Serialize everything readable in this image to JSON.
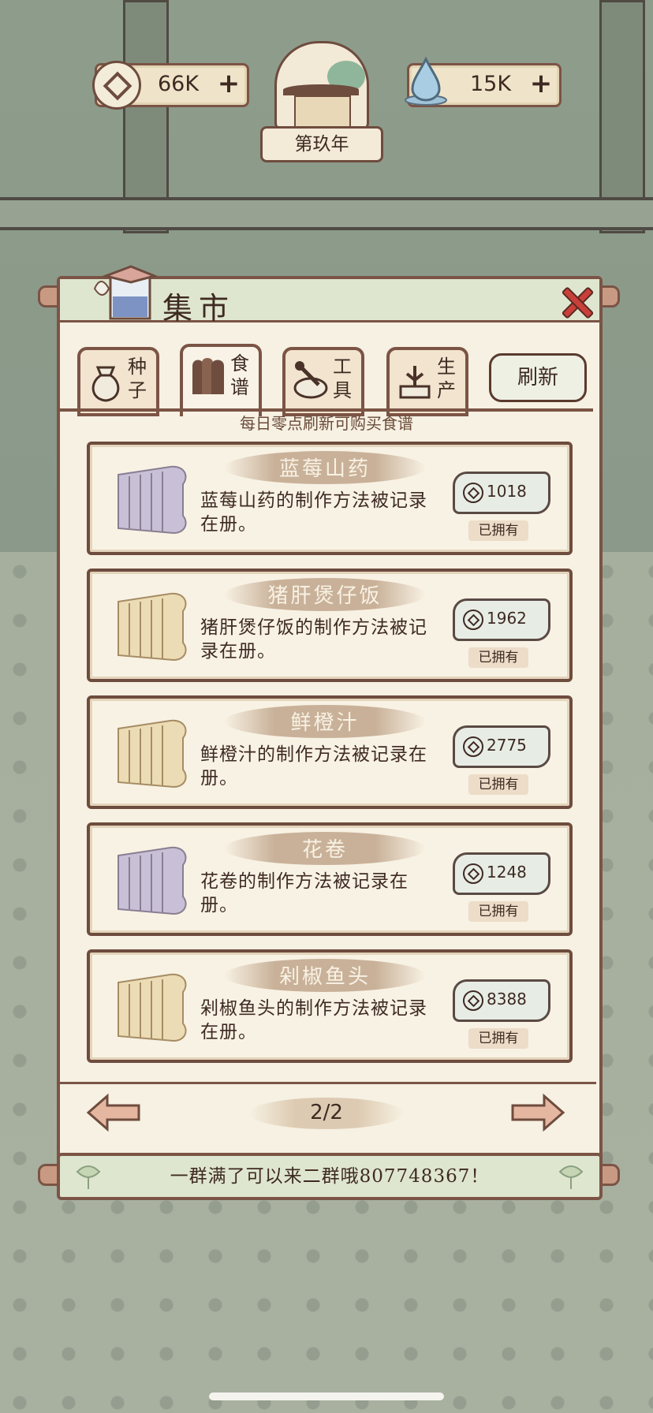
{
  "hud": {
    "coins": "66K",
    "water": "15K",
    "plus": "+",
    "year": "第玖年"
  },
  "panel": {
    "title": "集市",
    "hint": "每日零点刷新可购买食谱",
    "refresh_label": "刷新",
    "tabs": [
      {
        "label": "种子",
        "icon": "seed-bag-icon",
        "active": false
      },
      {
        "label": "食谱",
        "icon": "recipe-scroll-icon",
        "active": true
      },
      {
        "label": "工具",
        "icon": "tools-icon",
        "active": false
      },
      {
        "label": "生产",
        "icon": "production-icon",
        "active": false
      }
    ]
  },
  "recipes": [
    {
      "name": "蓝莓山药",
      "desc": "蓝莓山药的制作方法被记录在册。",
      "price": "1018",
      "status": "已拥有",
      "scroll_color": "#c7c0d6"
    },
    {
      "name": "猪肝煲仔饭",
      "desc": "猪肝煲仔饭的制作方法被记录在册。",
      "price": "1962",
      "status": "已拥有",
      "scroll_color": "#ecdcb5"
    },
    {
      "name": "鲜橙汁",
      "desc": "鲜橙汁的制作方法被记录在册。",
      "price": "2775",
      "status": "已拥有",
      "scroll_color": "#ecdcb5"
    },
    {
      "name": "花卷",
      "desc": "花卷的制作方法被记录在册。",
      "price": "1248",
      "status": "已拥有",
      "scroll_color": "#c7c0d6"
    },
    {
      "name": "剁椒鱼头",
      "desc": "剁椒鱼头的制作方法被记录在册。",
      "price": "8388",
      "status": "已拥有",
      "scroll_color": "#ecdcb5"
    }
  ],
  "pager": {
    "page": "2/2"
  },
  "footer": {
    "message": "一群满了可以来二群哦807748367！"
  },
  "colors": {
    "frame": "#7b5445",
    "close": "#c9403a",
    "panel_bg": "#f6f1e2",
    "header_bg": "#dfe6cf"
  }
}
